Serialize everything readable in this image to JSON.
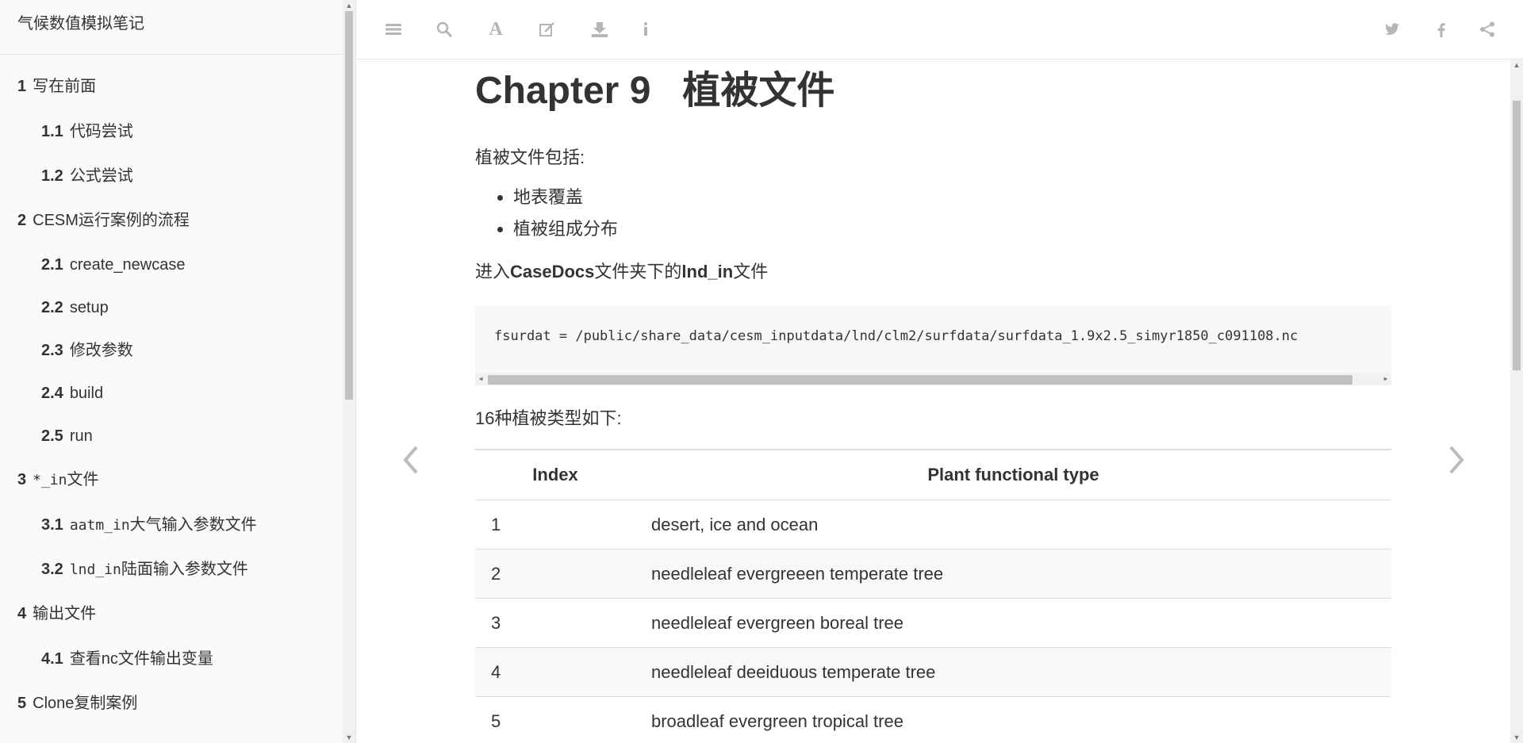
{
  "sidebar": {
    "title": "气候数值模拟笔记",
    "toc": [
      {
        "num": "1",
        "label": "写在前面"
      },
      {
        "num": "1.1",
        "label": "代码尝试"
      },
      {
        "num": "1.2",
        "label": "公式尝试"
      },
      {
        "num": "2",
        "label": "CESM运行案例的流程"
      },
      {
        "num": "2.1",
        "label": "create_newcase"
      },
      {
        "num": "2.2",
        "label": "setup"
      },
      {
        "num": "2.3",
        "label": "修改参数"
      },
      {
        "num": "2.4",
        "label": "build"
      },
      {
        "num": "2.5",
        "label": "run"
      },
      {
        "num": "3",
        "code": "*_in",
        "label": "文件"
      },
      {
        "num": "3.1",
        "code": "aatm_in",
        "label": "大气输入参数文件"
      },
      {
        "num": "3.2",
        "code": "lnd_in",
        "label": "陆面输入参数文件"
      },
      {
        "num": "4",
        "label": "输出文件"
      },
      {
        "num": "4.1",
        "label": "查看nc文件输出变量"
      },
      {
        "num": "5",
        "label": "Clone复制案例"
      }
    ]
  },
  "toolbar": {
    "left_icons": [
      "menu-icon",
      "search-icon",
      "font-icon",
      "edit-icon",
      "download-icon",
      "info-icon"
    ],
    "right_icons": [
      "twitter-icon",
      "facebook-icon",
      "share-icon"
    ]
  },
  "chapter": {
    "title": "Chapter 9   植被文件",
    "intro": "植被文件包括:",
    "bullets": [
      "地表覆盖",
      "植被组成分布"
    ],
    "enter_prefix": "进入",
    "enter_bold1": "CaseDocs",
    "enter_mid": "文件夹下的",
    "enter_bold2": "lnd_in",
    "enter_suffix": "文件",
    "code_line": "fsurdat = /public/share_data/cesm_inputdata/lnd/clm2/surfdata/surfdata_1.9x2.5_simyr1850_c091108.nc",
    "types_intro": "16种植被类型如下:",
    "table": {
      "headers": [
        "Index",
        "Plant functional type"
      ],
      "rows": [
        [
          "1",
          "desert, ice and ocean"
        ],
        [
          "2",
          "needleleaf evergreeen temperate tree"
        ],
        [
          "3",
          "needleleaf evergreen boreal tree"
        ],
        [
          "4",
          "needleleaf deeiduous temperate tree"
        ],
        [
          "5",
          "broadleaf evergreen tropical tree"
        ]
      ]
    }
  }
}
